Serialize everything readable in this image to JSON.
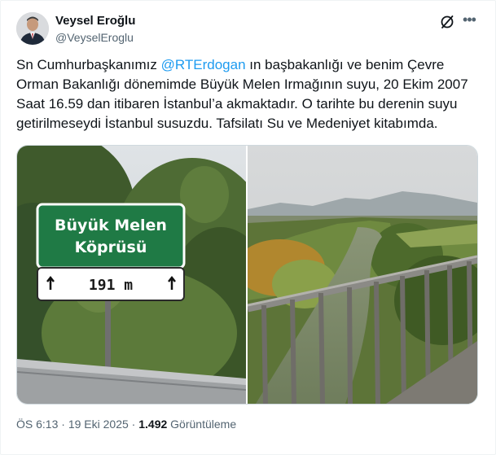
{
  "author": {
    "display_name": "Veysel Eroğlu",
    "handle": "@VeyselEroglu"
  },
  "header_icons": {
    "grok": "grok-icon",
    "more": "more-options-icon"
  },
  "tweet": {
    "text_before": "Sn Cumhurbaşkanımız ",
    "mention": "@RTErdogan",
    "text_after": " ın başbakanlığı ve benim Çevre Orman Bakanlığı dönemimde Büyük Melen Irmağının suyu, 20 Ekim 2007 Saat 16.59 dan itibaren İstanbul’a akmaktadır. O tarihte bu derenin suyu getirilmeseydi İstanbul susuzdu. Tafsilatı Su ve Medeniyet kitabımda."
  },
  "media": {
    "sign_line1": "Büyük Melen",
    "sign_line2": "Köprüsü",
    "sign_distance": "191 m"
  },
  "meta": {
    "time": "ÖS 6:13",
    "separator": " · ",
    "date": "19 Eki 2025",
    "views_count": "1.492",
    "views_label": " Görüntüleme"
  }
}
